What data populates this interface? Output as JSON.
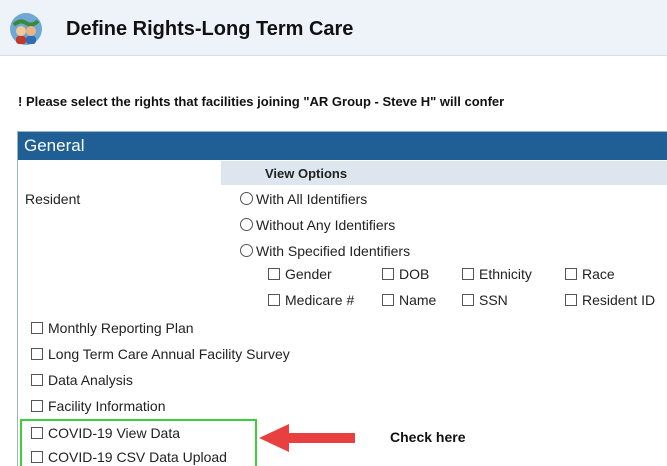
{
  "header": {
    "title": "Define Rights-Long Term Care",
    "logo_icon": "people-globe-icon"
  },
  "instruction": "! Please select the rights that facilities joining \"AR Group - Steve H\" will confer",
  "panel": {
    "title": "General",
    "view_options_label": "View Options",
    "resident_label": "Resident",
    "radios": [
      "With All Identifiers",
      "Without Any Identifiers",
      "With Specified Identifiers"
    ],
    "identifiers_row1": [
      "Gender",
      "DOB",
      "Ethnicity",
      "Race"
    ],
    "identifiers_row2": [
      "Medicare #",
      "Name",
      "SSN",
      "Resident ID"
    ],
    "rights": [
      "Monthly Reporting Plan",
      "Long Term Care Annual Facility Survey",
      "Data Analysis",
      "Facility Information",
      "COVID-19 View Data",
      "COVID-19 CSV Data Upload"
    ]
  },
  "annotation": {
    "note": "Check here",
    "highlight_color": "#3ccf3c",
    "arrow_color": "#e84040"
  },
  "colors": {
    "panel_header": "#1f5f95",
    "subheader": "#dde6ef",
    "page_header": "#eef3f9"
  }
}
